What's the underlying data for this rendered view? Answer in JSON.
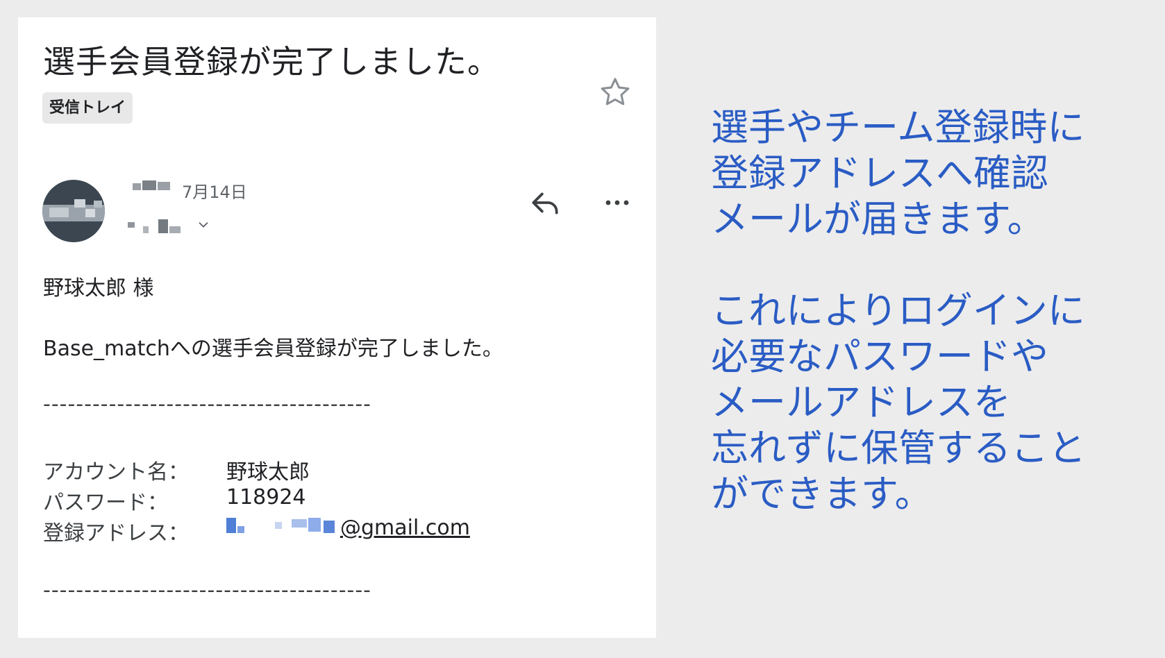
{
  "email": {
    "subject": "選手会員登録が完了しました。",
    "label": "受信トレイ",
    "date": "7月14日",
    "greeting": "野球太郎 様",
    "message": "Base_matchへの選手会員登録が完了しました。",
    "divider": "----------------------------------------",
    "account_label": "アカウント名：",
    "account_value": "野球太郎",
    "password_label": "パスワード：",
    "password_value": "118924",
    "address_label": "登録アドレス：",
    "address_domain": "@gmail.com"
  },
  "icons": {
    "star": "star-icon",
    "reply": "reply-icon",
    "more": "more-icon",
    "chevron": "chevron-down-icon"
  },
  "note": {
    "lines_1": [
      "選手やチーム登録時に",
      "登録アドレスへ確認",
      "メールが届きます。"
    ],
    "lines_2": [
      "これによりログインに",
      "必要なパスワードや",
      "メールアドレスを",
      "忘れずに保管すること",
      "ができます。"
    ]
  },
  "colors": {
    "background": "#ececec",
    "card": "#ffffff",
    "note_text": "#2a5cc4",
    "link": "#1a5ccf"
  }
}
